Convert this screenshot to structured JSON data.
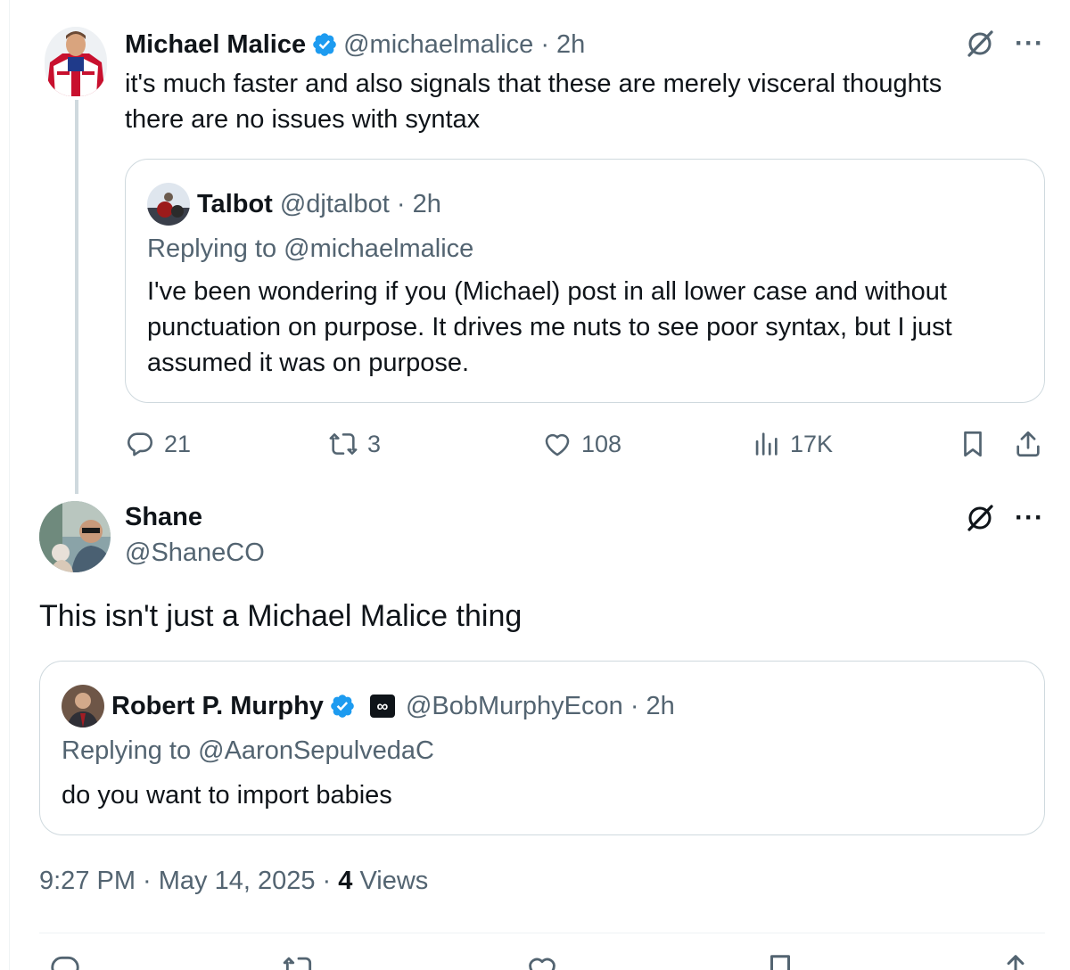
{
  "colors": {
    "text": "#0f1419",
    "secondary": "#536471",
    "border": "#cfd9de",
    "verified": "#1d9bf0"
  },
  "parent_tweet": {
    "author_name": "Michael Malice",
    "handle_time": "@michaelmalice · 2h",
    "text_line1": "it's much faster and also signals that these are merely visceral thoughts",
    "text_line2": "there are no issues with syntax",
    "more_label": "···",
    "quote": {
      "author_name": "Talbot",
      "handle_time": "@djtalbot · 2h",
      "replying_to": "Replying to @michaelmalice",
      "body_line1": "I've been wondering if you (Michael) post in all lower case and without",
      "body_line2": "punctuation on purpose. It drives me nuts to see poor syntax, but I just",
      "body_line3": "assumed it was on purpose."
    },
    "actions": {
      "replies": "21",
      "reposts": "3",
      "likes": "108",
      "views": "17K"
    }
  },
  "reply_tweet": {
    "author_name": "Shane",
    "handle": "@ShaneCO",
    "text": "This isn't just a Michael Malice thing",
    "more_label": "···",
    "quote": {
      "author_name": "Robert P. Murphy",
      "badge": "∞",
      "handle_time": "@BobMurphyEcon · 2h",
      "replying_to": "Replying to @AaronSepulvedaC",
      "body": "do you want to import babies"
    },
    "timestamp": "9:27 PM · May 14, 2025 · ",
    "views_count": "4",
    "views_label": " Views"
  }
}
